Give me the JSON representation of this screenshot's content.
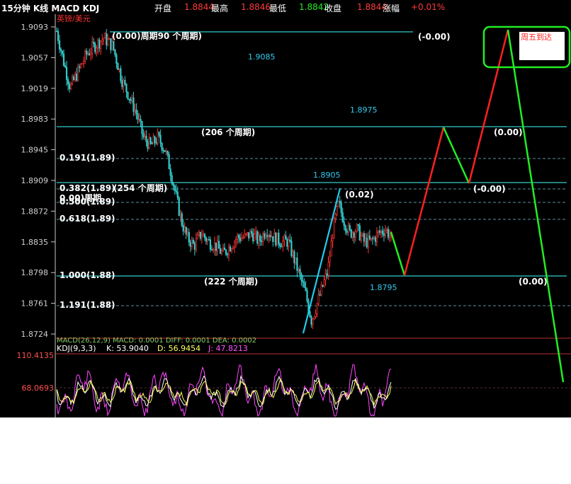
{
  "header": {
    "title": "15分钟 K线 MACD KDJ",
    "open_label": "开盘",
    "open_value": "1.8844",
    "high_label": "最高",
    "high_value": "1.8846",
    "low_label": "最低",
    "low_value": "1.8842",
    "close_label": "收盘",
    "close_value": "1.8844",
    "change_label": "涨幅",
    "change_value": "+0.01%"
  },
  "symbol": "英镑/美元",
  "y_ticks": [
    "1.9093",
    "1.9057",
    "1.9019",
    "1.8983",
    "1.8945",
    "1.8909",
    "1.8872",
    "1.8835",
    "1.8798",
    "1.8761",
    "1.8724"
  ],
  "fib_labels": [
    "0.191(1.89)",
    "0.382(1.89)",
    "0.500(1.89)",
    "0.618(1.89)",
    "1.000(1.88)",
    "1.191(1.88)"
  ],
  "zero_period": "0.00)周期",
  "period_labels": {
    "p90": "(0.00)周期90 个周期)",
    "p206": "(206 个周期)",
    "p254": "(254 个周期)",
    "p222": "(222 个周期)"
  },
  "level_values": {
    "l1": "1.9085",
    "l2": "1.8975",
    "l3": "1.8905",
    "l4": "1.8795"
  },
  "right_values": {
    "r1": "(-0.00)",
    "r2": "(0.00)",
    "r3": "(-0.00)",
    "r4": "(0.00)",
    "r5": "(0.02)"
  },
  "note": "周五到达",
  "macd_line": "MACD(26,12,9) MACD: 0.0001 DIFF: 0.0001 DEA: 0.0002",
  "kdj_line": {
    "label": "KDJ(9,3,3)",
    "k": "K: 53.9040",
    "d": "D: 56.9454",
    "j": "J: 47.8213"
  },
  "kdj_ticks": [
    "110.4135",
    "68.0693"
  ],
  "colors": {
    "up": "#ff3333",
    "down": "#33cccc",
    "line": "#33cccc",
    "proj_up": "#ff2020",
    "proj_down": "#22ee22",
    "fib": "#5f8fa0"
  },
  "chart_data": {
    "type": "candlestick",
    "title": "15分钟 K线",
    "ylim": [
      1.8724,
      1.9093
    ],
    "path_points": [
      [
        0,
        1.9088
      ],
      [
        8,
        1.905
      ],
      [
        15,
        1.902
      ],
      [
        24,
        1.904
      ],
      [
        33,
        1.906
      ],
      [
        42,
        1.907
      ],
      [
        52,
        1.908
      ],
      [
        62,
        1.907
      ],
      [
        72,
        1.903
      ],
      [
        80,
        1.901
      ],
      [
        88,
        1.899
      ],
      [
        96,
        1.896
      ],
      [
        104,
        1.895
      ],
      [
        112,
        1.896
      ],
      [
        120,
        1.8945
      ],
      [
        126,
        1.892
      ],
      [
        132,
        1.889
      ],
      [
        138,
        1.886
      ],
      [
        144,
        1.884
      ],
      [
        152,
        1.883
      ],
      [
        160,
        1.8845
      ],
      [
        168,
        1.8835
      ],
      [
        176,
        1.883
      ],
      [
        184,
        1.882
      ],
      [
        192,
        1.883
      ],
      [
        200,
        1.884
      ],
      [
        208,
        1.884
      ],
      [
        216,
        1.8845
      ],
      [
        224,
        1.8835
      ],
      [
        232,
        1.885
      ],
      [
        240,
        1.884
      ],
      [
        248,
        1.8835
      ],
      [
        256,
        1.8835
      ],
      [
        264,
        1.881
      ],
      [
        270,
        1.879
      ],
      [
        276,
        1.877
      ],
      [
        282,
        1.874
      ],
      [
        288,
        1.876
      ],
      [
        294,
        1.878
      ],
      [
        300,
        1.88
      ],
      [
        306,
        1.885
      ],
      [
        312,
        1.888
      ],
      [
        318,
        1.886
      ],
      [
        324,
        1.8845
      ],
      [
        332,
        1.885
      ],
      [
        340,
        1.8835
      ],
      [
        348,
        1.8835
      ],
      [
        356,
        1.8845
      ],
      [
        364,
        1.885
      ],
      [
        370,
        1.884
      ]
    ],
    "cyan_trend": [
      [
        1.8724
      ],
      [
        1.8895
      ]
    ],
    "projection": [
      1.8844,
      1.8795,
      1.8975,
      1.8905,
      1.9093,
      1.86
    ],
    "horizontal_levels": [
      1.909,
      1.8975,
      1.8905,
      1.8795
    ]
  }
}
